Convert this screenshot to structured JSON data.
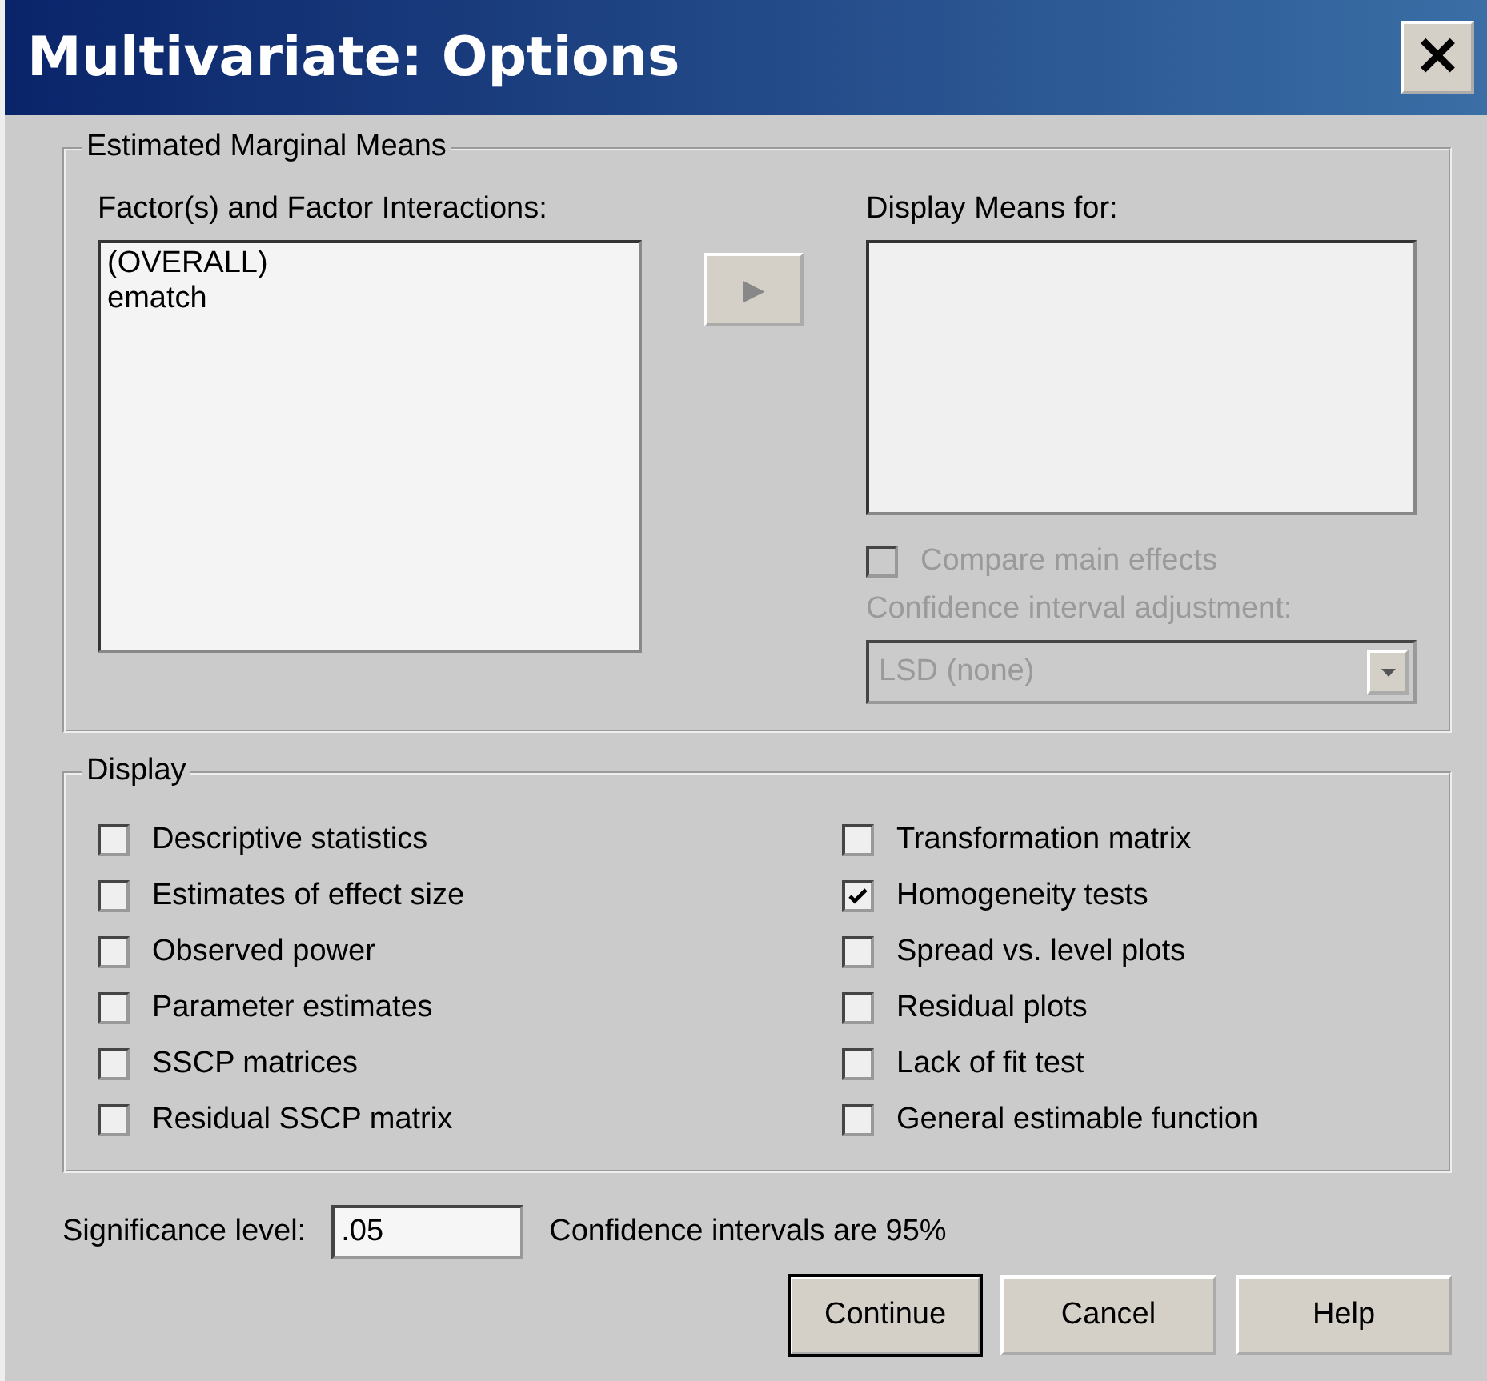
{
  "window": {
    "title": "Multivariate: Options",
    "close": "✕"
  },
  "marginal_means": {
    "title": "Estimated Marginal Means",
    "factors_label": "Factor(s) and Factor Interactions:",
    "factors": [
      {
        "label": "(OVERALL)",
        "selected": false
      },
      {
        "label": "ematch",
        "selected": false
      }
    ],
    "move_button": "▶",
    "display_label": "Display Means for:",
    "compare": {
      "label": "Compare main effects",
      "checked": false,
      "disabled": true
    },
    "adjustment_label": "Confidence interval adjustment:",
    "adjustment": {
      "value": "LSD (none)",
      "disabled": true
    }
  },
  "display": {
    "title": "Display",
    "options": [
      {
        "label": "Descriptive statistics",
        "checked": false
      },
      {
        "label": "Transformation matrix",
        "checked": false
      },
      {
        "label": "Estimates of effect size",
        "checked": false
      },
      {
        "label": "Homogeneity tests",
        "checked": true
      },
      {
        "label": "Observed power",
        "checked": false
      },
      {
        "label": "Spread vs. level plots",
        "checked": false
      },
      {
        "label": "Parameter estimates",
        "checked": false
      },
      {
        "label": "Residual plots",
        "checked": false
      },
      {
        "label": "SSCP matrices",
        "checked": false
      },
      {
        "label": "Lack of fit test",
        "checked": false
      },
      {
        "label": "Residual SSCP matrix",
        "checked": false
      },
      {
        "label": "General estimable function",
        "checked": false
      }
    ]
  },
  "significance": {
    "label": "Significance level:",
    "value": ".05",
    "note": "Confidence intervals are 95%"
  },
  "buttons": [
    {
      "label": "Continue",
      "default": true
    },
    {
      "label": "Cancel",
      "default": false
    },
    {
      "label": "Help",
      "default": false
    }
  ]
}
